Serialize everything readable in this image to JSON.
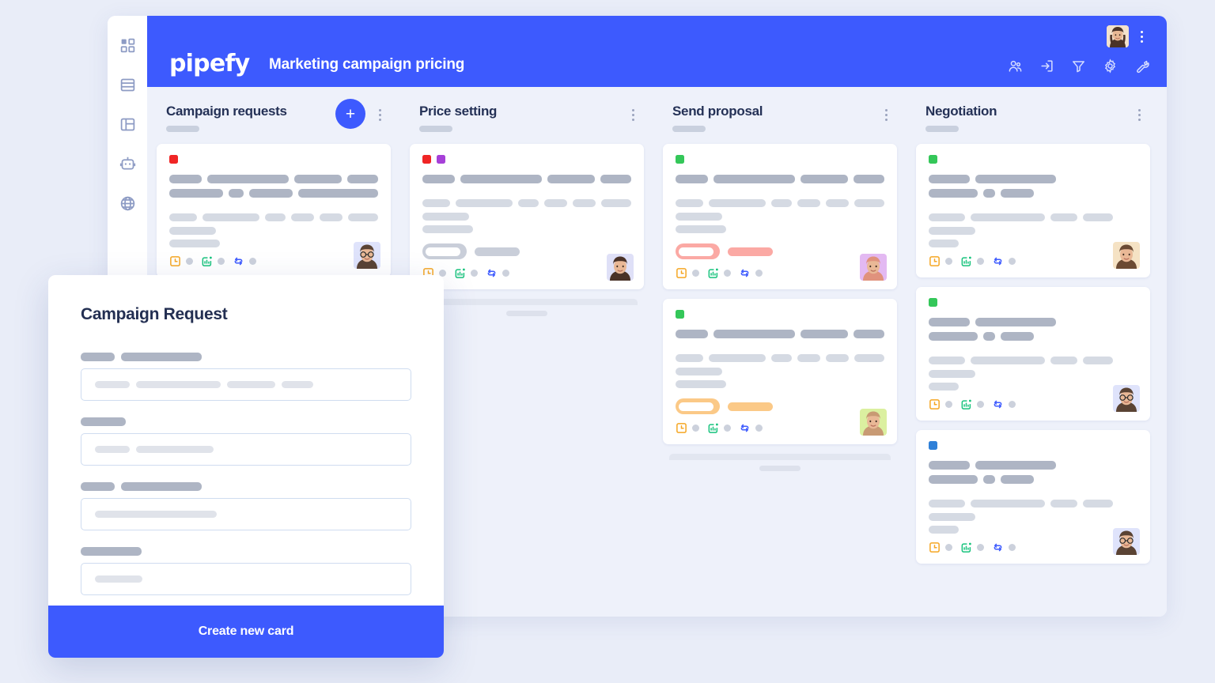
{
  "app": {
    "brand": "pipefy",
    "board_title": "Marketing campaign pricing",
    "accent_color": "#3d5afe",
    "background_color": "#e9edf8",
    "board_background": "#eef1fa"
  },
  "sidebar": {
    "items": [
      {
        "icon": "grid-dashboard-icon",
        "label": "Dashboard"
      },
      {
        "icon": "database-icon",
        "label": "Database"
      },
      {
        "icon": "layout-panel-icon",
        "label": "Layout"
      },
      {
        "icon": "robot-icon",
        "label": "Automations"
      },
      {
        "icon": "globe-icon",
        "label": "Portal"
      }
    ]
  },
  "header": {
    "avatar_label": "User avatar",
    "kebab_label": "More options",
    "tools": [
      {
        "icon": "members-icon",
        "label": "Members"
      },
      {
        "icon": "import-icon",
        "label": "Import"
      },
      {
        "icon": "filter-icon",
        "label": "Filter"
      },
      {
        "icon": "gear-icon",
        "label": "Settings"
      },
      {
        "icon": "wrench-icon",
        "label": "Tools"
      }
    ]
  },
  "board": {
    "add_card_label": "+",
    "columns": [
      {
        "title": "Campaign requests",
        "has_add_button": true,
        "has_ghost_stack": false,
        "cards": [
          {
            "tags": [
              "#f02525"
            ],
            "title_words": [
              52,
              130,
              76,
              50
            ],
            "title_words2": [
              76,
              22,
              62,
              113
            ],
            "meta_words": [
              46,
              94,
              34,
              38,
              38,
              50
            ],
            "body_lines": [
              59,
              64
            ],
            "pill": null,
            "avatar_bg": "#dfe3fb",
            "avatar_tone": "#5a4334"
          }
        ]
      },
      {
        "title": "Price setting",
        "has_add_button": false,
        "has_ghost_stack": true,
        "cards": [
          {
            "tags": [
              "#f02525",
              "#a640d8"
            ],
            "title_words": [
              52,
              130,
              76,
              50
            ],
            "title_words2": null,
            "meta_words": [
              46,
              94,
              34,
              38,
              38,
              50
            ],
            "body_lines": [
              59,
              64
            ],
            "pill": {
              "color": "#c9ced9",
              "inner": 44,
              "bar": 57
            },
            "avatar_bg": "#dfe0f7",
            "avatar_tone": "#4a3227"
          }
        ]
      },
      {
        "title": "Send proposal",
        "has_add_button": false,
        "has_ghost_stack": true,
        "cards": [
          {
            "tags": [
              "#34c759"
            ],
            "title_words": [
              52,
              130,
              76,
              50
            ],
            "title_words2": null,
            "meta_words": [
              46,
              94,
              34,
              38,
              38,
              50
            ],
            "body_lines": [
              59,
              64
            ],
            "pill": {
              "color": "#fba9a4",
              "inner": 44,
              "bar": 57
            },
            "avatar_bg": "#e3b9f2",
            "avatar_tone": "#e0927d"
          },
          {
            "tags": [
              "#34c759"
            ],
            "title_words": [
              52,
              130,
              76,
              50
            ],
            "title_words2": null,
            "meta_words": [
              46,
              94,
              34,
              38,
              38,
              50
            ],
            "body_lines": [
              59,
              64
            ],
            "pill": {
              "color": "#fbc987",
              "inner": 44,
              "bar": 57
            },
            "avatar_bg": "#dbf0a0",
            "avatar_tone": "#c89a74"
          }
        ]
      },
      {
        "title": "Negotiation",
        "has_add_button": false,
        "has_ghost_stack": false,
        "cards": [
          {
            "tags": [
              "#34c759"
            ],
            "title_words": [
              52,
              102
            ],
            "title_words2": [
              62,
              15,
              42
            ],
            "meta_words": [
              46,
              94,
              34,
              38
            ],
            "body_lines": [
              59,
              38
            ],
            "pill": null,
            "avatar_bg": "#f5e2c4",
            "avatar_tone": "#6b4a33"
          },
          {
            "tags": [
              "#34c759"
            ],
            "title_words": [
              52,
              102
            ],
            "title_words2": [
              62,
              15,
              42
            ],
            "meta_words": [
              46,
              94,
              34,
              38
            ],
            "body_lines": [
              59,
              38
            ],
            "pill": null,
            "avatar_bg": "#dfe3fb",
            "avatar_tone": "#5a4334"
          },
          {
            "tags": [
              "#2f80d8"
            ],
            "title_words": [
              52,
              102
            ],
            "title_words2": [
              62,
              15,
              42
            ],
            "meta_words": [
              46,
              94,
              34,
              38
            ],
            "body_lines": [
              59,
              38
            ],
            "pill": null,
            "avatar_bg": "#dfe3fb",
            "avatar_tone": "#5a4334"
          }
        ]
      }
    ],
    "card_footer_icons": [
      {
        "icon": "clock-due-date-icon",
        "color": "#f5a623"
      },
      {
        "icon": "chart-growth-icon",
        "color": "#18c37d"
      },
      {
        "icon": "connection-flow-icon",
        "color": "#3d5afe"
      }
    ]
  },
  "modal": {
    "title": "Campaign Request",
    "submit_label": "Create new card",
    "fields": [
      {
        "label_widths": [
          43,
          102
        ],
        "placeholder_widths": [
          44,
          107,
          61,
          40
        ]
      },
      {
        "label_widths": [
          57
        ],
        "placeholder_widths": [
          44,
          98
        ]
      },
      {
        "label_widths": [
          43,
          102
        ],
        "placeholder_widths": [
          154
        ]
      },
      {
        "label_widths": [
          77
        ],
        "placeholder_widths": [
          60
        ]
      }
    ]
  }
}
